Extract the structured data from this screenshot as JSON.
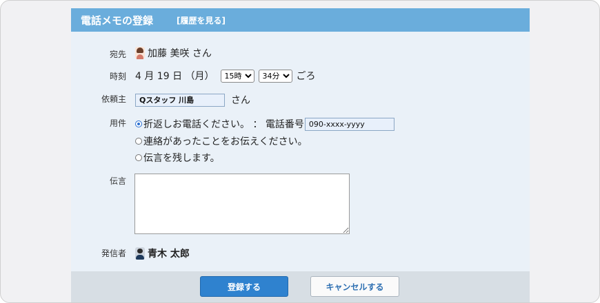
{
  "header": {
    "title": "電話メモの登録",
    "history_link": "[履歴を見る]"
  },
  "recipient": {
    "label": "宛先",
    "name": "加藤 美咲 さん"
  },
  "time": {
    "label": "時刻",
    "date_text": "4 月 19 日 （月）",
    "hour": "15時",
    "minute": "34分",
    "suffix": "ごろ"
  },
  "requester": {
    "label": "依頼主",
    "value": "Qスタッフ 川島",
    "suffix": "さん"
  },
  "business": {
    "label": "用件",
    "options": [
      {
        "text": "折返しお電話ください。 ： 電話番号",
        "selected": true
      },
      {
        "text": "連絡があったことをお伝えください。",
        "selected": false
      },
      {
        "text": "伝言を残します。",
        "selected": false
      }
    ],
    "phone": "090-xxxx-yyyy"
  },
  "message": {
    "label": "伝言",
    "value": ""
  },
  "sender": {
    "label": "発信者",
    "name": "青木 太郎"
  },
  "buttons": {
    "submit": "登録する",
    "cancel": "キャンセルする"
  },
  "colors": {
    "header": "#6aaddc",
    "panel": "#eaf1f8",
    "primary_button": "#2f82cf"
  }
}
